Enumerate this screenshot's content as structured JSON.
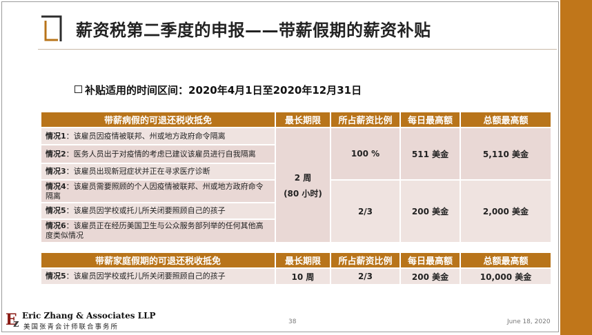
{
  "slide": {
    "title": "薪资税第二季度的申报——带薪假期的薪资补贴",
    "subtitle": "补贴适用的时间区间：2020年4月1日至2020年12月31日"
  },
  "sick_table": {
    "headers": [
      "带薪病假的可退还税收抵免",
      "最长期限",
      "所占薪资比例",
      "每日最高额",
      "总额最高额"
    ],
    "cases": [
      {
        "label": "情况1",
        "text": "：该雇员因疫情被联邦、州或地方政府命令隔离"
      },
      {
        "label": "情况2",
        "text": "：医务人员出于对疫情的考虑已建议该雇员进行自我隔离"
      },
      {
        "label": "情况3",
        "text": "：该雇员出现新冠症状并正在寻求医疗诊断"
      },
      {
        "label": "情况4",
        "text": "：该雇员需要照顾的个人因疫情被联邦、州或地方政府命令隔离"
      },
      {
        "label": "情况5",
        "text": "：该雇员因学校或托儿所关闭要照顾自己的孩子"
      },
      {
        "label": "情况6",
        "text": "：该雇员正在经历美国卫生与公众服务部列举的任何其他高度类似情况"
      }
    ],
    "duration_line1": "2 周",
    "duration_line2": "(80 小时)",
    "group1": {
      "ratio": "100 %",
      "daily": "511 美金",
      "total": "5,110 美金"
    },
    "group2": {
      "ratio": "2/3",
      "daily": "200 美金",
      "total": "2,000 美金"
    }
  },
  "family_table": {
    "headers": [
      "带薪家庭假期的可退还税收抵免",
      "最长期限",
      "所占薪资比例",
      "每日最高额",
      "总额最高额"
    ],
    "case": {
      "label": "情况5",
      "text": "：该雇员因学校或托儿所关闭要照顾自己的孩子"
    },
    "duration": "10 周",
    "ratio": "2/3",
    "daily": "200 美金",
    "total": "10,000 美金"
  },
  "footer": {
    "firm_en": "Eric Zhang & Associates LLP",
    "firm_cn": "美国张青会计师联合事务所",
    "page_number": "38",
    "date": "June 18, 2020"
  },
  "colors": {
    "accent": "#b8741a",
    "band": "#c0761a",
    "row_light": "#efe3e0",
    "row_dark": "#e9d8d5"
  }
}
